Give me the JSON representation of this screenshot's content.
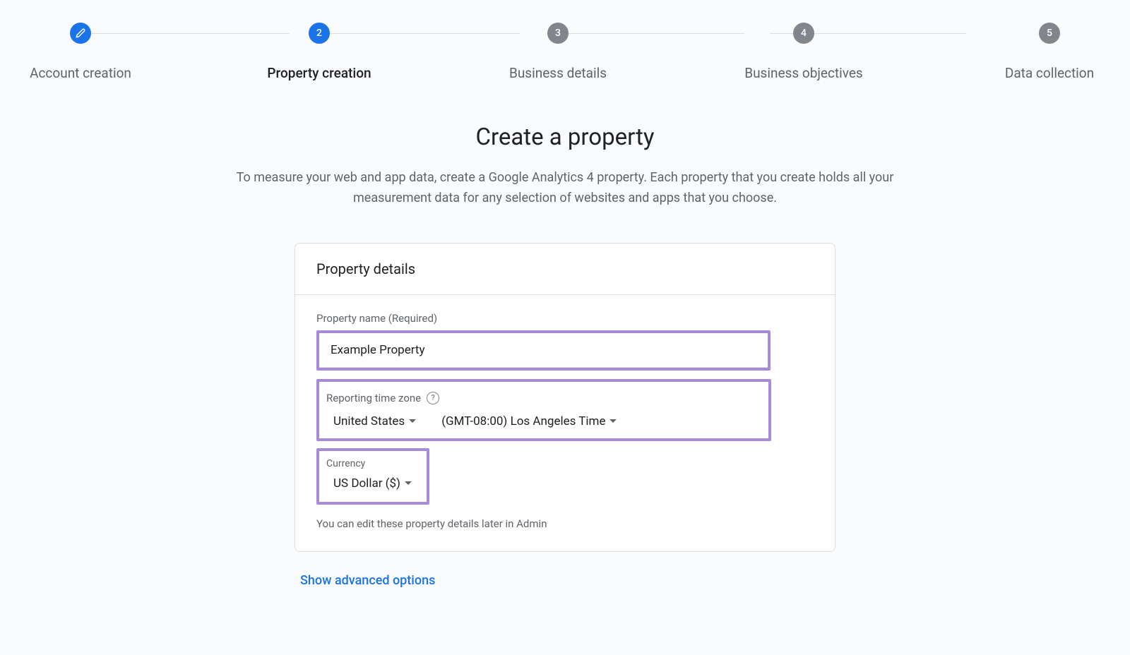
{
  "stepper": {
    "steps": [
      {
        "label": "Account creation",
        "state": "done",
        "icon": "pencil"
      },
      {
        "label": "Property creation",
        "state": "active",
        "number": "2"
      },
      {
        "label": "Business details",
        "state": "pending",
        "number": "3"
      },
      {
        "label": "Business objectives",
        "state": "pending",
        "number": "4"
      },
      {
        "label": "Data collection",
        "state": "pending",
        "number": "5"
      }
    ]
  },
  "main": {
    "title": "Create a property",
    "subtitle": "To measure your web and app data, create a Google Analytics 4 property. Each property that you create holds all your measurement data for any selection of websites and apps that you choose."
  },
  "card": {
    "title": "Property details",
    "property_name": {
      "label": "Property name (Required)",
      "value": "Example Property"
    },
    "time_zone": {
      "label": "Reporting time zone",
      "country": "United States",
      "zone": "(GMT-08:00) Los Angeles Time"
    },
    "currency": {
      "label": "Currency",
      "value": "US Dollar ($)"
    },
    "footnote": "You can edit these property details later in Admin"
  },
  "advanced": {
    "label": "Show advanced options"
  }
}
